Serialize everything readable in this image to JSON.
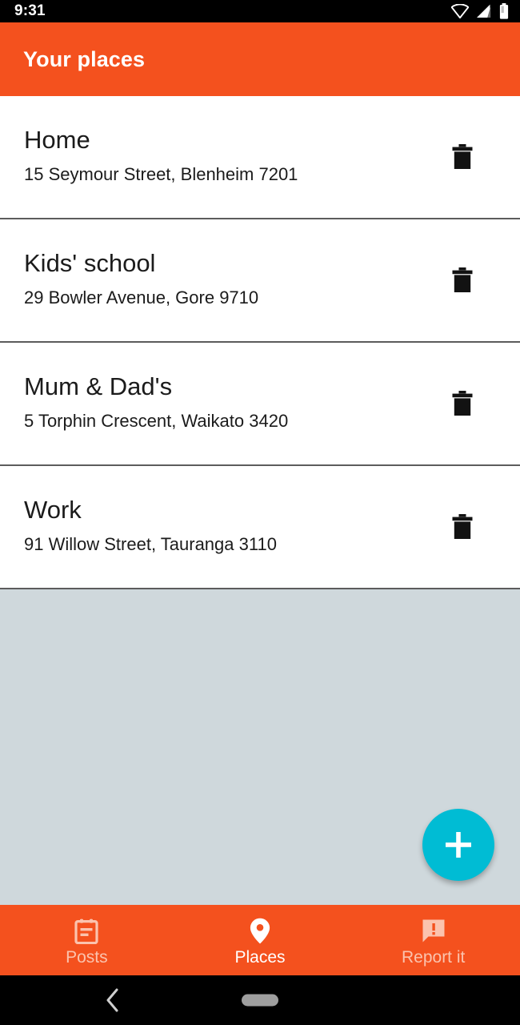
{
  "status_bar": {
    "time": "9:31",
    "icons": [
      "wifi-icon",
      "cellular-signal-icon",
      "battery-icon"
    ]
  },
  "app_bar": {
    "title": "Your places"
  },
  "places": [
    {
      "name": "Home",
      "address": "15 Seymour Street, Blenheim 7201",
      "delete_icon": "trash-icon"
    },
    {
      "name": "Kids' school",
      "address": "29 Bowler Avenue, Gore 9710",
      "delete_icon": "trash-icon"
    },
    {
      "name": "Mum & Dad's",
      "address": "5 Torphin Crescent, Waikato 3420",
      "delete_icon": "trash-icon"
    },
    {
      "name": "Work",
      "address": "91 Willow Street, Tauranga 3110",
      "delete_icon": "trash-icon"
    }
  ],
  "fab": {
    "icon": "plus-icon",
    "label": "+"
  },
  "bottom_nav": {
    "items": [
      {
        "label": "Posts",
        "icon": "posts-note-icon",
        "active": false
      },
      {
        "label": "Places",
        "icon": "map-pin-icon",
        "active": true
      },
      {
        "label": "Report it",
        "icon": "report-speech-bubble-icon",
        "active": false
      }
    ]
  },
  "system_nav": {
    "back_icon": "back-chevron-icon",
    "home_icon": "home-pill-icon"
  },
  "colors": {
    "brand_orange": "#f4511e",
    "accent_cyan": "#00bcd4",
    "empty_background": "#cfd8dc",
    "nav_inactive_label": "#fbc3ae",
    "text_primary": "#1b1b1b",
    "status_bar": "#000000"
  }
}
